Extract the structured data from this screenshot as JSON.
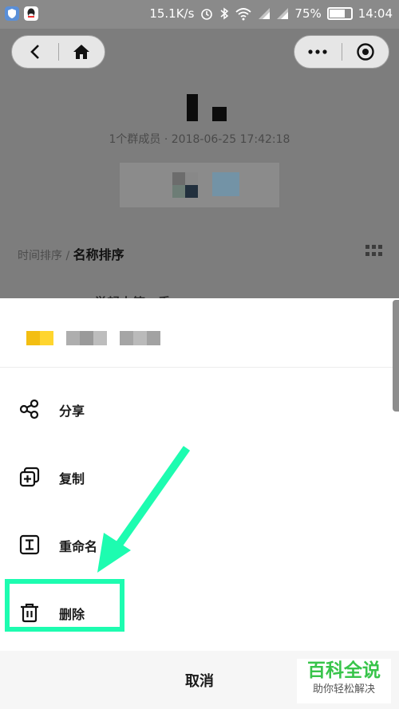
{
  "status_bar": {
    "network_speed": "15.1K/s",
    "battery_percent": "75%",
    "battery_level": 0.75,
    "time": "14:04",
    "icons": [
      "security-app-icon",
      "qq-app-icon",
      "alarm-icon",
      "bluetooth-icon",
      "wifi-icon",
      "signal-icon",
      "signal-icon",
      "battery-icon"
    ]
  },
  "background_page": {
    "meta": "1个群成员 · 2018-06-25 17:42:18",
    "sort": {
      "time_label": "时间排序 / ",
      "name_label": "名称排序"
    },
    "peek_text": "举起山第一季"
  },
  "action_sheet": {
    "items": [
      {
        "label": "分享",
        "icon": "share-icon"
      },
      {
        "label": "复制",
        "icon": "copy-icon"
      },
      {
        "label": "重命名",
        "icon": "rename-icon"
      },
      {
        "label": "删除",
        "icon": "trash-icon"
      }
    ],
    "cancel_label": "取消"
  },
  "annotation": {
    "color": "#1dfcb0"
  },
  "watermark": {
    "main": "百科全说",
    "sub": "助你轻松解决"
  },
  "colors": {
    "accent_yellow": "#f5c518",
    "watermark_green": "#38c44a"
  }
}
